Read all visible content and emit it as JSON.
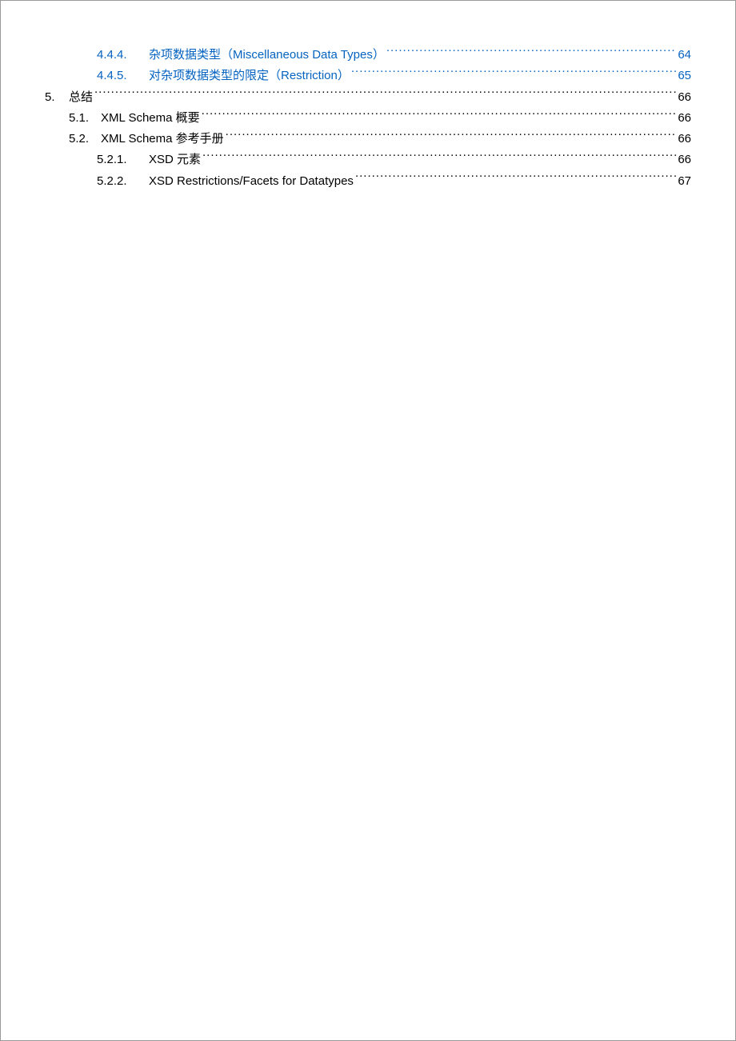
{
  "toc": [
    {
      "level": 3,
      "kind": "link",
      "num": "4.4.4.",
      "title": "杂项数据类型（Miscellaneous Data Types）",
      "page": "64"
    },
    {
      "level": 3,
      "kind": "link",
      "num": "4.4.5.",
      "title": "对杂项数据类型的限定（Restriction）",
      "page": "65"
    },
    {
      "level": 1,
      "kind": "plain",
      "num": "5.",
      "title": "总结",
      "page": "66"
    },
    {
      "level": 2,
      "kind": "plain",
      "num": "5.1.",
      "title": "XML Schema  概要",
      "page": "66"
    },
    {
      "level": 2,
      "kind": "plain",
      "num": "5.2.",
      "title": "XML Schema  参考手册",
      "page": "66"
    },
    {
      "level": 3,
      "kind": "plain",
      "num": "5.2.1.",
      "title": "XSD  元素",
      "page": "66"
    },
    {
      "level": 3,
      "kind": "plain",
      "num": "5.2.2.",
      "title": "XSD Restrictions/Facets for Datatypes",
      "page": "67"
    }
  ]
}
